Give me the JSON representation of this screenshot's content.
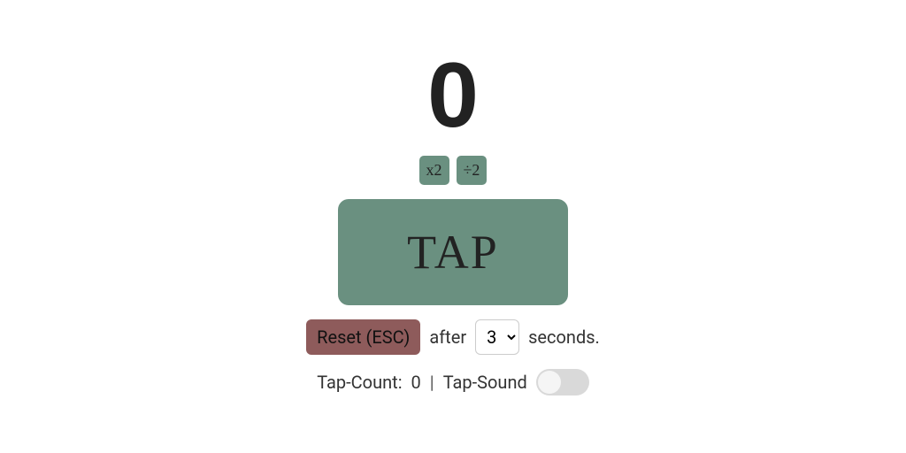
{
  "display": {
    "bpm_value": "0"
  },
  "math": {
    "double_label": "x2",
    "halve_label": "÷2"
  },
  "tap": {
    "label": "TAP"
  },
  "reset": {
    "button_label": "Reset (ESC)",
    "after_label": "after",
    "seconds_value": "3",
    "seconds_label": "seconds."
  },
  "status": {
    "tap_count_label": "Tap-Count:",
    "tap_count_value": "0",
    "divider": "|",
    "tap_sound_label": "Tap-Sound",
    "tap_sound_on": false
  }
}
